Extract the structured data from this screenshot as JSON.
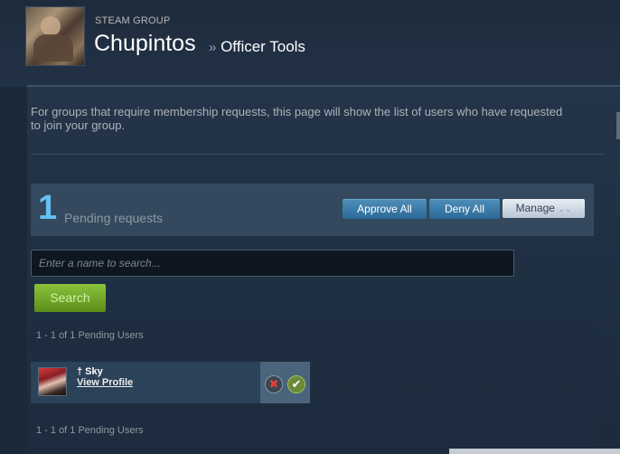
{
  "header": {
    "group_label": "STEAM GROUP",
    "group_name": "Chupintos",
    "separator": "»",
    "section_title": "Officer Tools"
  },
  "intro_text": "For groups that require membership requests, this page will show the list of users who have requested to join your group.",
  "pending": {
    "count": "1",
    "label": "Pending requests",
    "approve_all_label": "Approve All",
    "deny_all_label": "Deny All",
    "manage_label": "Manage"
  },
  "search": {
    "placeholder": "Enter a name to search...",
    "value": "",
    "button_label": "Search"
  },
  "pager": {
    "top_text": "1 - 1 of 1 Pending Users",
    "bottom_text": "1 - 1 of 1 Pending Users"
  },
  "members": [
    {
      "name": "† Sky",
      "profile_link": "View Profile",
      "deny_icon": "x-icon",
      "approve_icon": "check-icon"
    }
  ],
  "colors": {
    "background": "#1b2838",
    "accent_blue": "#66c0f4",
    "search_green": "#5c8d1a"
  }
}
